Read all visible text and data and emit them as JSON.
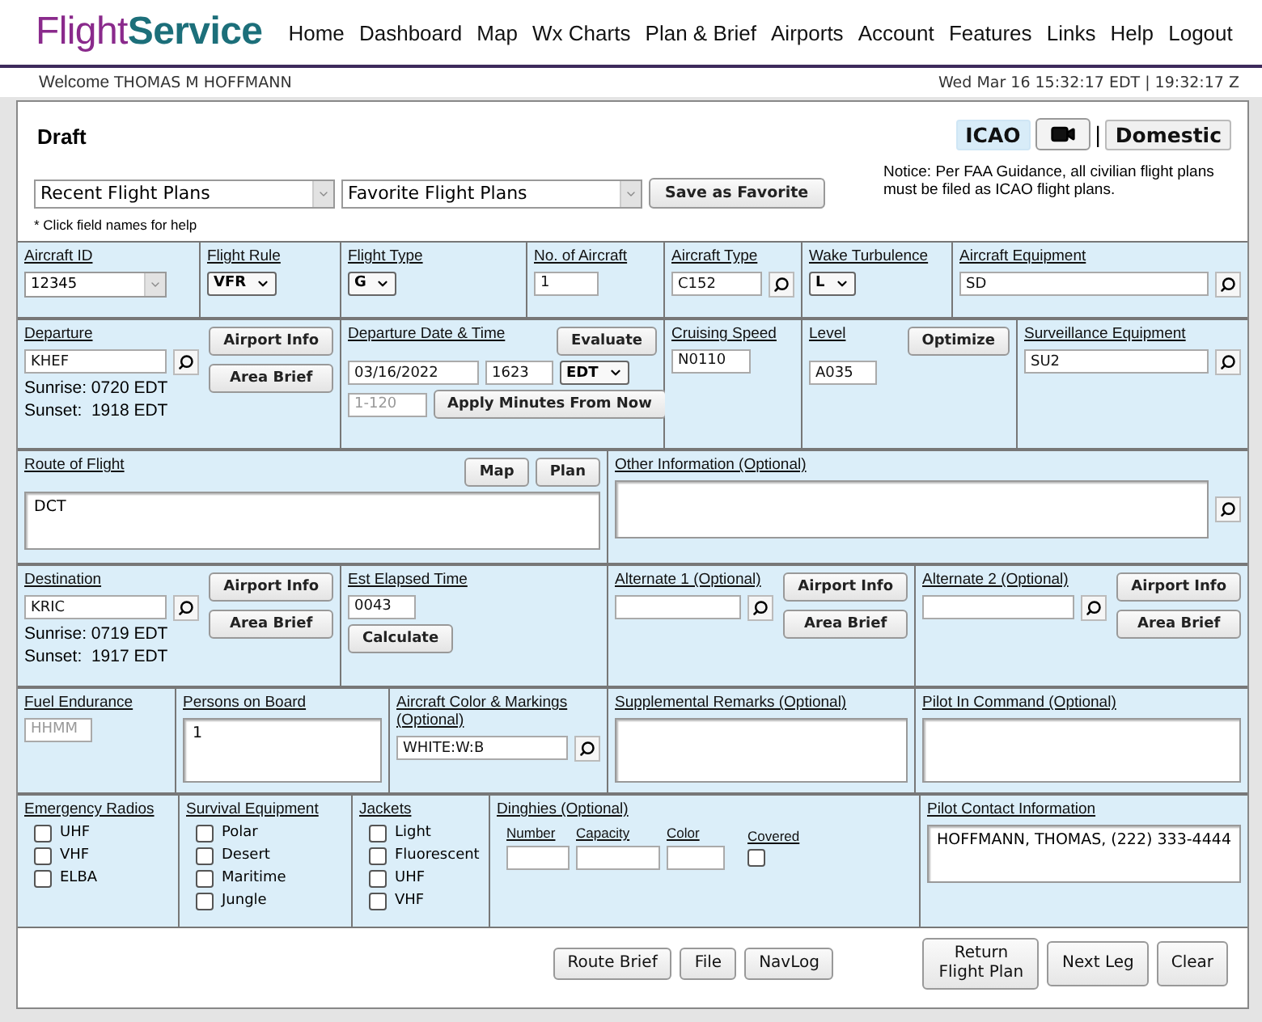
{
  "logo": {
    "part_1": "Flight",
    "part_2": "Service"
  },
  "nav": [
    "Home",
    "Dashboard",
    "Map",
    "Wx Charts",
    "Plan & Brief",
    "Airports",
    "Account",
    "Features",
    "Links",
    "Help",
    "Logout"
  ],
  "welcome": {
    "greeting": "Welcome",
    "user": "THOMAS M HOFFMANN",
    "datetime": "Wed Mar 16 15:32:17 EDT | 19:32:17 Z"
  },
  "panel": {
    "title": "Draft",
    "formats": [
      {
        "label": "ICAO",
        "selected": true
      },
      {
        "label": "Domestic",
        "selected": false
      }
    ],
    "separator": "|",
    "notice": "Notice: Per FAA Guidance, all civilian flight plans must be filed as ICAO flight plans.",
    "recent": "Recent Flight Plans",
    "favorite": "Favorite Flight Plans",
    "save_button": "Save as Favorite",
    "hint": "* Click field names for help"
  },
  "rows": [
    [
      {
        "label": "Aircraft ID",
        "lines": [
          [
            {
              "kind": "combo",
              "value": "12345"
            }
          ]
        ]
      },
      {
        "label": "Flight Rule",
        "lines": [
          [
            {
              "kind": "select",
              "value": "VFR"
            }
          ]
        ]
      },
      {
        "label": "Flight Type",
        "lines": [
          [
            {
              "kind": "select",
              "value": "G"
            }
          ]
        ]
      },
      {
        "label": "No. of Aircraft",
        "lines": [
          [
            {
              "kind": "input",
              "value": "1"
            }
          ]
        ]
      },
      {
        "label": "Aircraft Type",
        "lines": [
          [
            {
              "kind": "input",
              "value": "C152"
            },
            {
              "kind": "search"
            }
          ]
        ]
      },
      {
        "label": "Wake Turbulence",
        "lines": [
          [
            {
              "kind": "select",
              "value": "L"
            }
          ]
        ]
      },
      {
        "label": "Aircraft Equipment",
        "lines": [
          [
            {
              "kind": "input",
              "value": "SD"
            },
            {
              "kind": "search"
            }
          ]
        ]
      }
    ],
    [
      {
        "label": "Departure",
        "kind": "airport",
        "actions": [
          "Airport Info",
          "Area Brief"
        ],
        "lines": [
          [
            {
              "kind": "input",
              "value": "KHEF"
            },
            {
              "kind": "search"
            }
          ],
          [
            {
              "kind": "text",
              "text": "Sunrise: 0720 EDT"
            }
          ],
          [
            {
              "kind": "text",
              "text": "Sunset:  1918 EDT"
            }
          ]
        ]
      },
      {
        "label": "Departure Date & Time",
        "actions": [
          "Evaluate"
        ],
        "lines": [
          [
            {
              "kind": "input",
              "value": "03/16/2022"
            },
            {
              "kind": "input",
              "value": "1623"
            },
            {
              "kind": "select",
              "value": "EDT"
            }
          ],
          [
            {
              "kind": "input",
              "placeholder": "1-120"
            },
            {
              "kind": "button",
              "label": "Apply Minutes From Now"
            }
          ]
        ]
      },
      {
        "label": "Cruising Speed",
        "lines": [
          [
            {
              "kind": "input",
              "value": "N0110"
            }
          ]
        ]
      },
      {
        "label": "Level",
        "actions": [
          "Optimize"
        ],
        "lines": [
          [
            {
              "kind": "input",
              "value": "A035"
            }
          ]
        ]
      },
      {
        "label": "Surveillance Equipment",
        "lines": [
          [
            {
              "kind": "input",
              "value": "SU2"
            },
            {
              "kind": "search"
            }
          ]
        ]
      }
    ],
    [
      {
        "label": "Route of Flight",
        "actions": [
          "Map",
          "Plan"
        ],
        "lines": [
          [
            {
              "kind": "textarea",
              "value": "DCT"
            }
          ]
        ]
      },
      {
        "label": "Other Information (Optional)",
        "lines": [
          [
            {
              "kind": "textarea"
            },
            {
              "kind": "search"
            }
          ]
        ]
      }
    ],
    [
      {
        "label": "Destination",
        "kind": "airport",
        "actions": [
          "Airport Info",
          "Area Brief"
        ],
        "lines": [
          [
            {
              "kind": "input",
              "value": "KRIC"
            },
            {
              "kind": "search"
            }
          ],
          [
            {
              "kind": "text",
              "text": "Sunrise: 0719 EDT"
            }
          ],
          [
            {
              "kind": "text",
              "text": "Sunset:  1917 EDT"
            }
          ]
        ]
      },
      {
        "label": "Est Elapsed Time",
        "lines": [
          [
            {
              "kind": "input",
              "value": "0043"
            }
          ],
          [
            {
              "kind": "button",
              "label": "Calculate"
            }
          ]
        ]
      },
      {
        "label": "Alternate 1 (Optional)",
        "kind": "airport",
        "actions": [
          "Airport Info",
          "Area Brief"
        ],
        "lines": [
          [
            {
              "kind": "input"
            },
            {
              "kind": "search"
            }
          ]
        ]
      },
      {
        "label": "Alternate 2 (Optional)",
        "kind": "airport",
        "actions": [
          "Airport Info",
          "Area Brief"
        ],
        "lines": [
          [
            {
              "kind": "input"
            },
            {
              "kind": "search"
            }
          ]
        ]
      }
    ],
    [
      {
        "label": "Fuel Endurance",
        "lines": [
          [
            {
              "kind": "input",
              "placeholder": "HHMM"
            }
          ]
        ]
      },
      {
        "label": "Persons on Board",
        "lines": [
          [
            {
              "kind": "textarea",
              "value": "1"
            }
          ]
        ]
      },
      {
        "label": "Aircraft Color & Markings (Optional)",
        "lines": [
          [
            {
              "kind": "input",
              "value": "WHITE:W:B"
            },
            {
              "kind": "search"
            }
          ]
        ]
      },
      {
        "label": "Supplemental Remarks (Optional)",
        "lines": [
          [
            {
              "kind": "textarea"
            }
          ]
        ]
      },
      {
        "label": "Pilot In Command (Optional)",
        "lines": [
          [
            {
              "kind": "textarea"
            }
          ]
        ]
      }
    ],
    [
      {
        "label": "Emergency Radios",
        "lines": [
          [
            {
              "kind": "checkbox",
              "label": "UHF",
              "checked": false
            }
          ],
          [
            {
              "kind": "checkbox",
              "label": "VHF",
              "checked": false
            }
          ],
          [
            {
              "kind": "checkbox",
              "label": "ELBA",
              "checked": false
            }
          ]
        ]
      },
      {
        "label": "Survival Equipment",
        "lines": [
          [
            {
              "kind": "checkbox",
              "label": "Polar",
              "checked": false
            }
          ],
          [
            {
              "kind": "checkbox",
              "label": "Desert",
              "checked": false
            }
          ],
          [
            {
              "kind": "checkbox",
              "label": "Maritime",
              "checked": false
            }
          ],
          [
            {
              "kind": "checkbox",
              "label": "Jungle",
              "checked": false
            }
          ]
        ]
      },
      {
        "label": "Jackets",
        "lines": [
          [
            {
              "kind": "checkbox",
              "label": "Light",
              "checked": false
            }
          ],
          [
            {
              "kind": "checkbox",
              "label": "Fluorescent",
              "checked": false
            }
          ],
          [
            {
              "kind": "checkbox",
              "label": "UHF",
              "checked": false
            }
          ],
          [
            {
              "kind": "checkbox",
              "label": "VHF",
              "checked": false
            }
          ]
        ]
      },
      {
        "label": "Dinghies (Optional)",
        "lines": [
          [
            {
              "kind": "labeled-input",
              "label": "Number"
            },
            {
              "kind": "labeled-input",
              "label": "Capacity"
            },
            {
              "kind": "labeled-input",
              "label": "Color"
            },
            {
              "kind": "labeled-checkbox",
              "label": "Covered",
              "checked": false
            }
          ]
        ]
      },
      {
        "label": "Pilot Contact Information",
        "lines": [
          [
            {
              "kind": "textarea",
              "value": "HOFFMANN, THOMAS, (222) 333-4444"
            }
          ]
        ]
      }
    ]
  ],
  "footer": {
    "center": [
      "Route Brief",
      "File",
      "NavLog"
    ],
    "right": [
      "Return Flight Plan",
      "Next Leg",
      "Clear"
    ]
  }
}
